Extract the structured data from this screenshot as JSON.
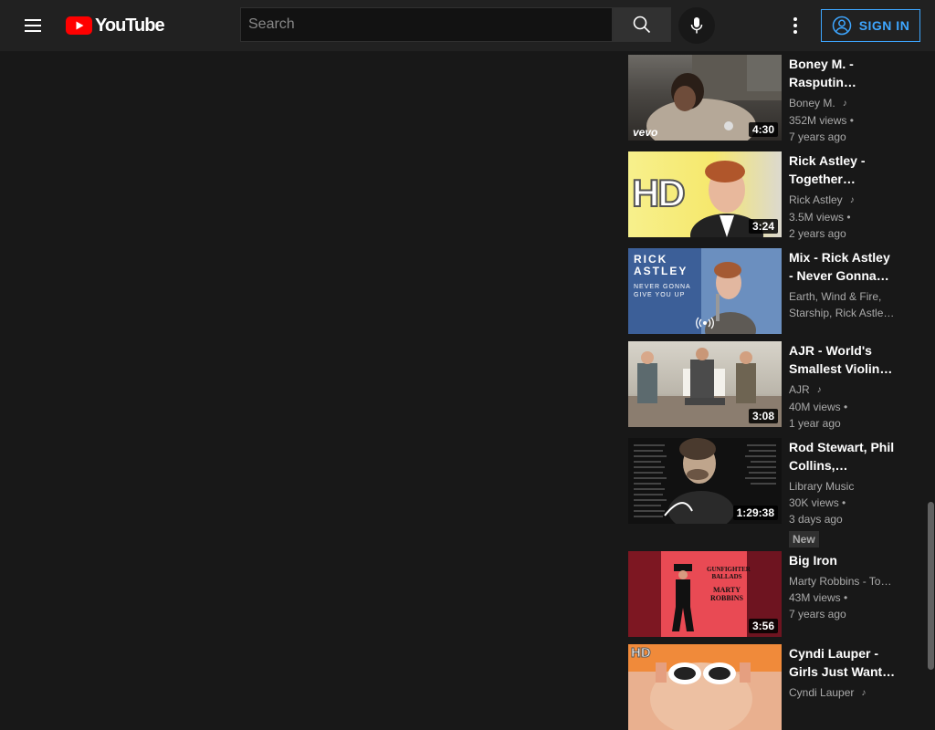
{
  "header": {
    "logo_text": "YouTube",
    "search_placeholder": "Search",
    "signin_label": "SIGN IN"
  },
  "colors": {
    "background": "#181818",
    "topbar": "#212121",
    "accent": "#3ea6ff",
    "logo_red": "#ff0000"
  },
  "icons": [
    "menu-icon",
    "youtube-logo-icon",
    "search-icon",
    "microphone-icon",
    "more-vert-icon",
    "account-circle-icon",
    "music-note-icon",
    "live-broadcast-icon"
  ],
  "videos": [
    {
      "title": "Boney M. - Rasputin (Sopot…",
      "line1": "Boney M.",
      "line2": "352M views •",
      "line3": "7 years ago",
      "duration": "4:30",
      "thumb_text": "vevo"
    },
    {
      "title": "Rick Astley - Together Foreve…",
      "line1": "Rick Astley",
      "line2": "3.5M views •",
      "line3": "2 years ago",
      "duration": "3:24",
      "thumb_text": "HD"
    },
    {
      "title": "Mix - Rick Astley - Never Gonna Gi…",
      "line1": "Earth, Wind & Fire,",
      "line2": "Starship, Rick Astle…",
      "line3": "",
      "duration": "",
      "thumb_text_1": "RICK",
      "thumb_text_2": "ASTLEY",
      "thumb_text_3": "NEVER GONNA",
      "thumb_text_4": "GIVE YOU UP"
    },
    {
      "title": "AJR - World's Smallest Violin…",
      "line1": "AJR",
      "line2": "40M views •",
      "line3": "1 year ago",
      "duration": "3:08"
    },
    {
      "title": "Rod Stewart, Phil Collins,…",
      "line1": "Library Music",
      "line2": "30K views •",
      "line3": "3 days ago",
      "duration": "1:29:38",
      "badge": "New"
    },
    {
      "title": "Big Iron",
      "line1": "Marty Robbins - To…",
      "line2": "43M views •",
      "line3": "7 years ago",
      "duration": "3:56",
      "thumb_text_1": "GUNFIGHTER",
      "thumb_text_2": "BALLADS",
      "thumb_text_3": "MARTY",
      "thumb_text_4": "ROBBINS"
    },
    {
      "title": "Cyndi Lauper - Girls Just Want…",
      "line1": "Cyndi Lauper",
      "line2": "",
      "line3": "",
      "duration": "",
      "thumb_text": "HD"
    }
  ]
}
